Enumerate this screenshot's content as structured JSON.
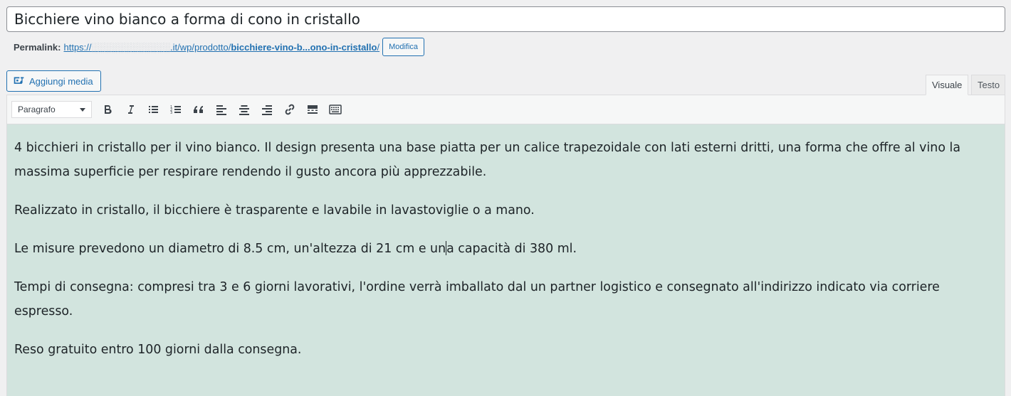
{
  "post": {
    "title": "Bicchiere vino bianco a forma di cono in cristallo"
  },
  "permalink": {
    "label": "Permalink:",
    "url_prefix": "https://",
    "url_hidden": "░░░░░░░░░░░░",
    "url_path": ".it/wp/prodotto/",
    "url_slug": "bicchiere-vino-b...ono-in-cristallo",
    "url_suffix": "/",
    "edit_button": "Modifica"
  },
  "media": {
    "add_button": "Aggiungi media",
    "icon": "camera-music-icon"
  },
  "tabs": {
    "visual": "Visuale",
    "text": "Testo"
  },
  "toolbar": {
    "format_selected": "Paragrafo",
    "buttons": [
      {
        "name": "bold-icon"
      },
      {
        "name": "italic-icon"
      },
      {
        "name": "bullet-list-icon"
      },
      {
        "name": "numbered-list-icon"
      },
      {
        "name": "blockquote-icon"
      },
      {
        "name": "align-left-icon"
      },
      {
        "name": "align-center-icon"
      },
      {
        "name": "align-right-icon"
      },
      {
        "name": "link-icon"
      },
      {
        "name": "read-more-icon"
      },
      {
        "name": "toolbar-toggle-icon"
      }
    ]
  },
  "content": {
    "paragraphs": [
      "4 bicchieri in cristallo per il vino bianco. Il design presenta una base piatta per un calice trapezoidale con lati esterni dritti, una forma che offre al vino la massima superficie per respirare rendendo il gusto ancora più apprezzabile.",
      "Realizzato in cristallo, il bicchiere è trasparente e lavabile in lavastoviglie o a mano.",
      "Le misure prevedono un diametro di 8.5 cm, un'altezza di 21 cm e un",
      "a capacità di 380 ml.",
      "Tempi di consegna: compresi tra 3 e 6 giorni lavorativi, l'ordine verrà imballato dal un partner logistico e consegnato all'indirizzo indicato via corriere espresso.",
      "Reso gratuito entro 100 giorni dalla consegna."
    ]
  },
  "colors": {
    "accent": "#2271b1",
    "editor_background": "#d2e4de",
    "page_background": "#f0f0f1"
  }
}
